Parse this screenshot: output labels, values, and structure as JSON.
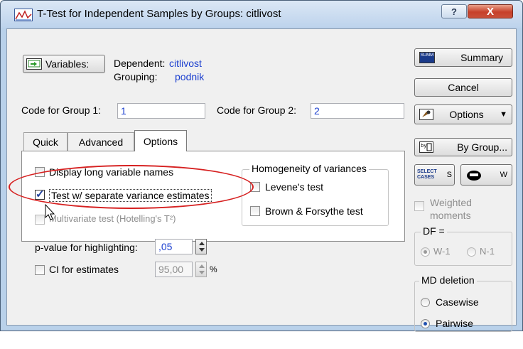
{
  "window": {
    "title": "T-Test for Independent Samples by Groups: citlivost",
    "help_glyph": "?",
    "close_glyph": "X"
  },
  "variables_button": {
    "label": "Variables:"
  },
  "dependent": {
    "label": "Dependent:",
    "value": "citlivost"
  },
  "grouping": {
    "label": "Grouping:",
    "value": "podnik"
  },
  "code_group1": {
    "label": "Code for Group 1:",
    "value": "1"
  },
  "code_group2": {
    "label": "Code for Group 2:",
    "value": "2"
  },
  "tabs": [
    {
      "label": "Quick"
    },
    {
      "label": "Advanced"
    },
    {
      "label": "Options"
    }
  ],
  "options": {
    "display_long_names": {
      "label": "Display long variable names",
      "checked": false
    },
    "separate_variance": {
      "label": "Test w/ separate variance estimates",
      "checked": true
    },
    "multivariate": {
      "label": "Multivariate test (Hotelling's T²)",
      "checked": false
    },
    "p_value": {
      "label": "p-value for highlighting:",
      "value": ",05"
    },
    "ci": {
      "label": "CI for estimates",
      "value": "95,00",
      "unit": "%"
    }
  },
  "homogeneity": {
    "title": "Homogeneity of variances",
    "levene": "Levene's test",
    "brown": "Brown & Forsythe test"
  },
  "right_panel": {
    "summary": "Summary",
    "summary_icon_text": "SUMM",
    "cancel": "Cancel",
    "options": "Options",
    "by_group": "By Group...",
    "select_cases": "SELECT CASES",
    "select_s": "S",
    "weight_w": "W",
    "weighted_moments": "Weighted moments",
    "df_title": "DF =",
    "df_w1": "W-1",
    "df_n1": "N-1",
    "md_title": "MD deletion",
    "casewise": "Casewise",
    "pairwise": "Pairwise"
  },
  "colors": {
    "accent": "#1a3ecf",
    "highlight": "#d62020"
  }
}
